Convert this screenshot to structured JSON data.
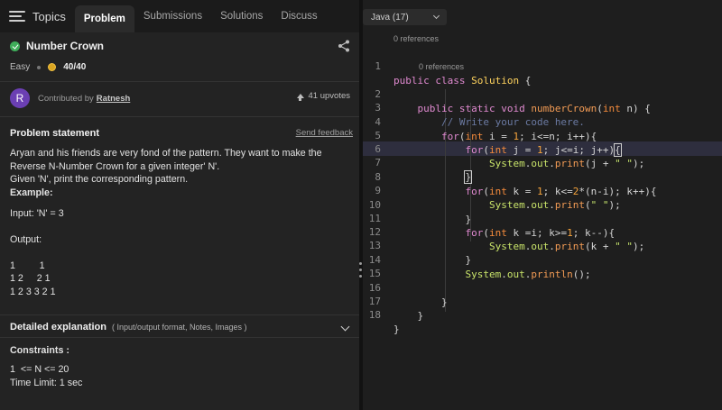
{
  "tabs": {
    "topics": "Topics",
    "items": [
      "Problem",
      "Submissions",
      "Solutions",
      "Discuss"
    ]
  },
  "problem": {
    "title": "Number Crown",
    "difficulty": "Easy",
    "score": "40/40",
    "contributed_by_label": "Contributed by",
    "contributor": "Ratnesh",
    "upvotes": "41 upvotes",
    "statement_heading": "Problem statement",
    "send_feedback": "Send feedback",
    "statement_line1": "Aryan and his friends are very fond of the pattern. They want to make the",
    "statement_line2": "Reverse N-Number Crown for a given integer' N'.",
    "statement_line3": "Given 'N', print the corresponding pattern.",
    "example_label": "Example:",
    "input_line": "Input: 'N' = 3",
    "output_label": "Output:",
    "output_rows": [
      "1         1",
      "1 2     2 1",
      "1 2 3 3 2 1"
    ],
    "detailed_label": "Detailed explanation",
    "detailed_sub": "( Input/output format, Notes, Images )",
    "constraints_label": "Constraints :",
    "constraint1": "1  <= N <= 20",
    "time_limit": "Time Limit: 1 sec"
  },
  "editor": {
    "language": "Java (17)",
    "references_1": "0 references",
    "references_2": "0 references",
    "line_numbers": [
      "1",
      "2",
      "3",
      "4",
      "5",
      "6",
      "7",
      "8",
      "9",
      "10",
      "11",
      "12",
      "13",
      "14",
      "15",
      "16",
      "17",
      "18"
    ]
  },
  "colors": {
    "accent_success": "#3fae5a",
    "coin": "#d9a521",
    "avatar": "#6b3fb3"
  },
  "icons": [
    "menu-icon",
    "solved-check-icon",
    "share-icon",
    "coin-icon",
    "upvote-icon",
    "chevron-down-icon"
  ]
}
